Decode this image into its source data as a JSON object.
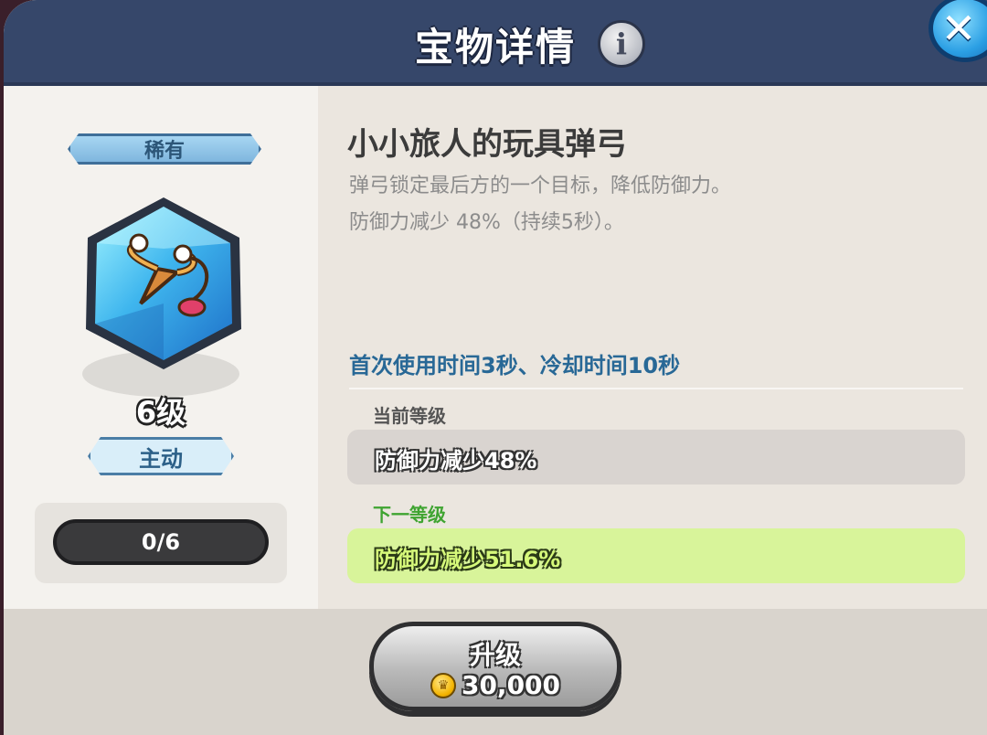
{
  "header": {
    "title": "宝物详情",
    "info_icon": "info-icon",
    "close_icon": "close-icon"
  },
  "treasure": {
    "rarity": "稀有",
    "icon": "slingshot-icon",
    "level": "6级",
    "skill_type": "主动",
    "progress_text": "0/6",
    "name": "小小旅人的玩具弹弓",
    "description_lines": [
      "弹弓锁定最后方的一个目标，降低防御力。",
      "防御力减少 48%（持续5秒）。"
    ],
    "cooldown_text": "首次使用时间3秒、冷却时间10秒",
    "current_level_label": "当前等级",
    "current_effect": "防御力减少48%",
    "next_level_label": "下一等级",
    "next_effect": "防御力减少51.6%"
  },
  "upgrade": {
    "label": "升级",
    "cost": "30,000",
    "currency_icon": "coin-icon"
  },
  "colors": {
    "header_bg": "#36476a",
    "cooldown_text": "#286896",
    "next_label": "#3fa431",
    "next_box": "#d8f49a",
    "rarity_badge": "#8fc4e8"
  }
}
